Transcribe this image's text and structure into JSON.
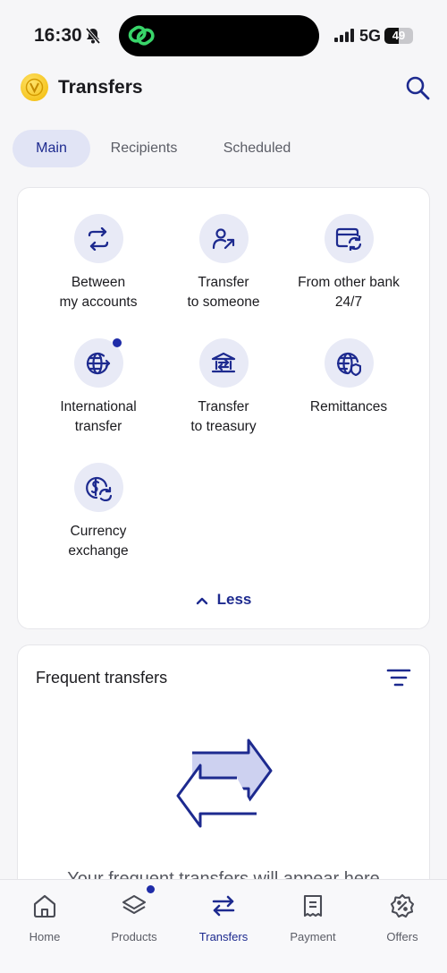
{
  "status": {
    "time": "16:30",
    "network": "5G",
    "battery": "49",
    "battery_level": 0.49
  },
  "header": {
    "title": "Transfers"
  },
  "tabs": [
    {
      "label": "Main",
      "active": true
    },
    {
      "label": "Recipients",
      "active": false
    },
    {
      "label": "Scheduled",
      "active": false
    }
  ],
  "services": [
    {
      "line1": "Between",
      "line2": "my accounts",
      "icon": "swap-arrows-icon"
    },
    {
      "line1": "Transfer",
      "line2": "to someone",
      "icon": "person-arrow-icon"
    },
    {
      "line1": "From other bank",
      "line2": "24/7",
      "icon": "card-refresh-icon"
    },
    {
      "line1": "International",
      "line2": "transfer",
      "icon": "globe-arrow-icon",
      "badge": true
    },
    {
      "line1": "Transfer",
      "line2": "to treasury",
      "icon": "bank-arrow-icon"
    },
    {
      "line1": "Remittances",
      "line2": "",
      "icon": "globe-shield-icon"
    },
    {
      "line1": "Currency",
      "line2": "exchange",
      "icon": "currency-exchange-icon"
    }
  ],
  "less_label": "Less",
  "frequent": {
    "title": "Frequent transfers",
    "empty_text": "Your frequent transfers will appear here"
  },
  "nav": [
    {
      "label": "Home",
      "icon": "home-icon"
    },
    {
      "label": "Products",
      "icon": "layers-icon",
      "badge": true
    },
    {
      "label": "Transfers",
      "icon": "transfer-arrows-icon",
      "active": true
    },
    {
      "label": "Payment",
      "icon": "receipt-icon"
    },
    {
      "label": "Offers",
      "icon": "discount-badge-icon"
    }
  ],
  "colors": {
    "accent": "#1d2a8f",
    "icon_bg": "#e8eaf6",
    "tab_active_bg": "#e1e4f5"
  }
}
